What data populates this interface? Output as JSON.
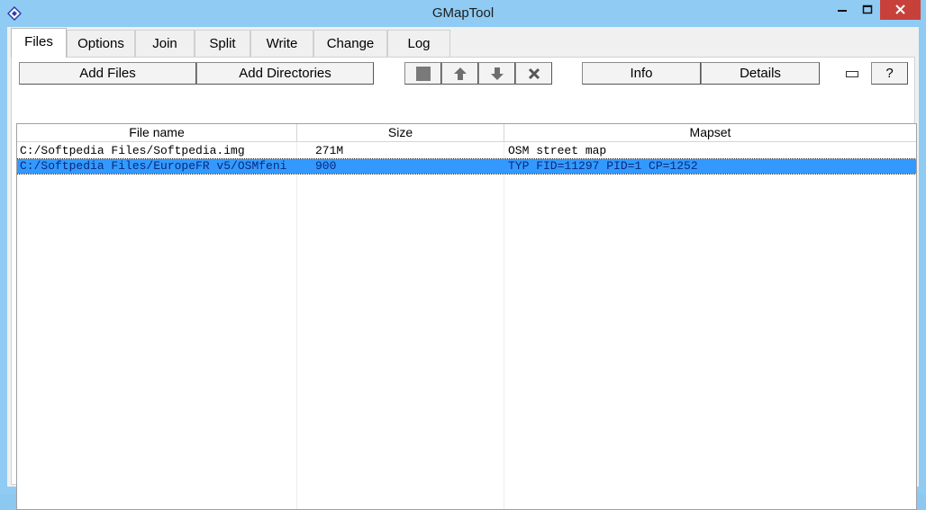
{
  "window": {
    "title": "GMapTool",
    "controls": {
      "minimize": "—",
      "maximize": "☐",
      "close": "✕"
    }
  },
  "tabs": [
    {
      "label": "Files",
      "active": true
    },
    {
      "label": "Options"
    },
    {
      "label": "Join"
    },
    {
      "label": "Split"
    },
    {
      "label": "Write"
    },
    {
      "label": "Change"
    },
    {
      "label": "Log"
    }
  ],
  "toolbar": {
    "add_files": "Add Files",
    "add_directories": "Add Directories",
    "info": "Info",
    "details": "Details",
    "help": "?",
    "icons": [
      "stop-square-icon",
      "arrow-up-icon",
      "arrow-down-icon",
      "remove-x-icon",
      "small-toggle-icon"
    ]
  },
  "table": {
    "columns": [
      "File name",
      "Size",
      "Mapset"
    ],
    "rows": [
      {
        "file": "C:/Softpedia Files/Softpedia.img",
        "size": "271M",
        "mapset": "OSM street map",
        "selected": false
      },
      {
        "file": "C:/Softpedia Files/EuropeFR v5/OSMfeni",
        "size": "900",
        "mapset": "TYP  FID=11297 PID=1 CP=1252",
        "selected": true
      }
    ]
  },
  "colors": {
    "titlebar": "#8fcbf3",
    "close_button": "#c7413a",
    "selection": "#3399ff"
  }
}
